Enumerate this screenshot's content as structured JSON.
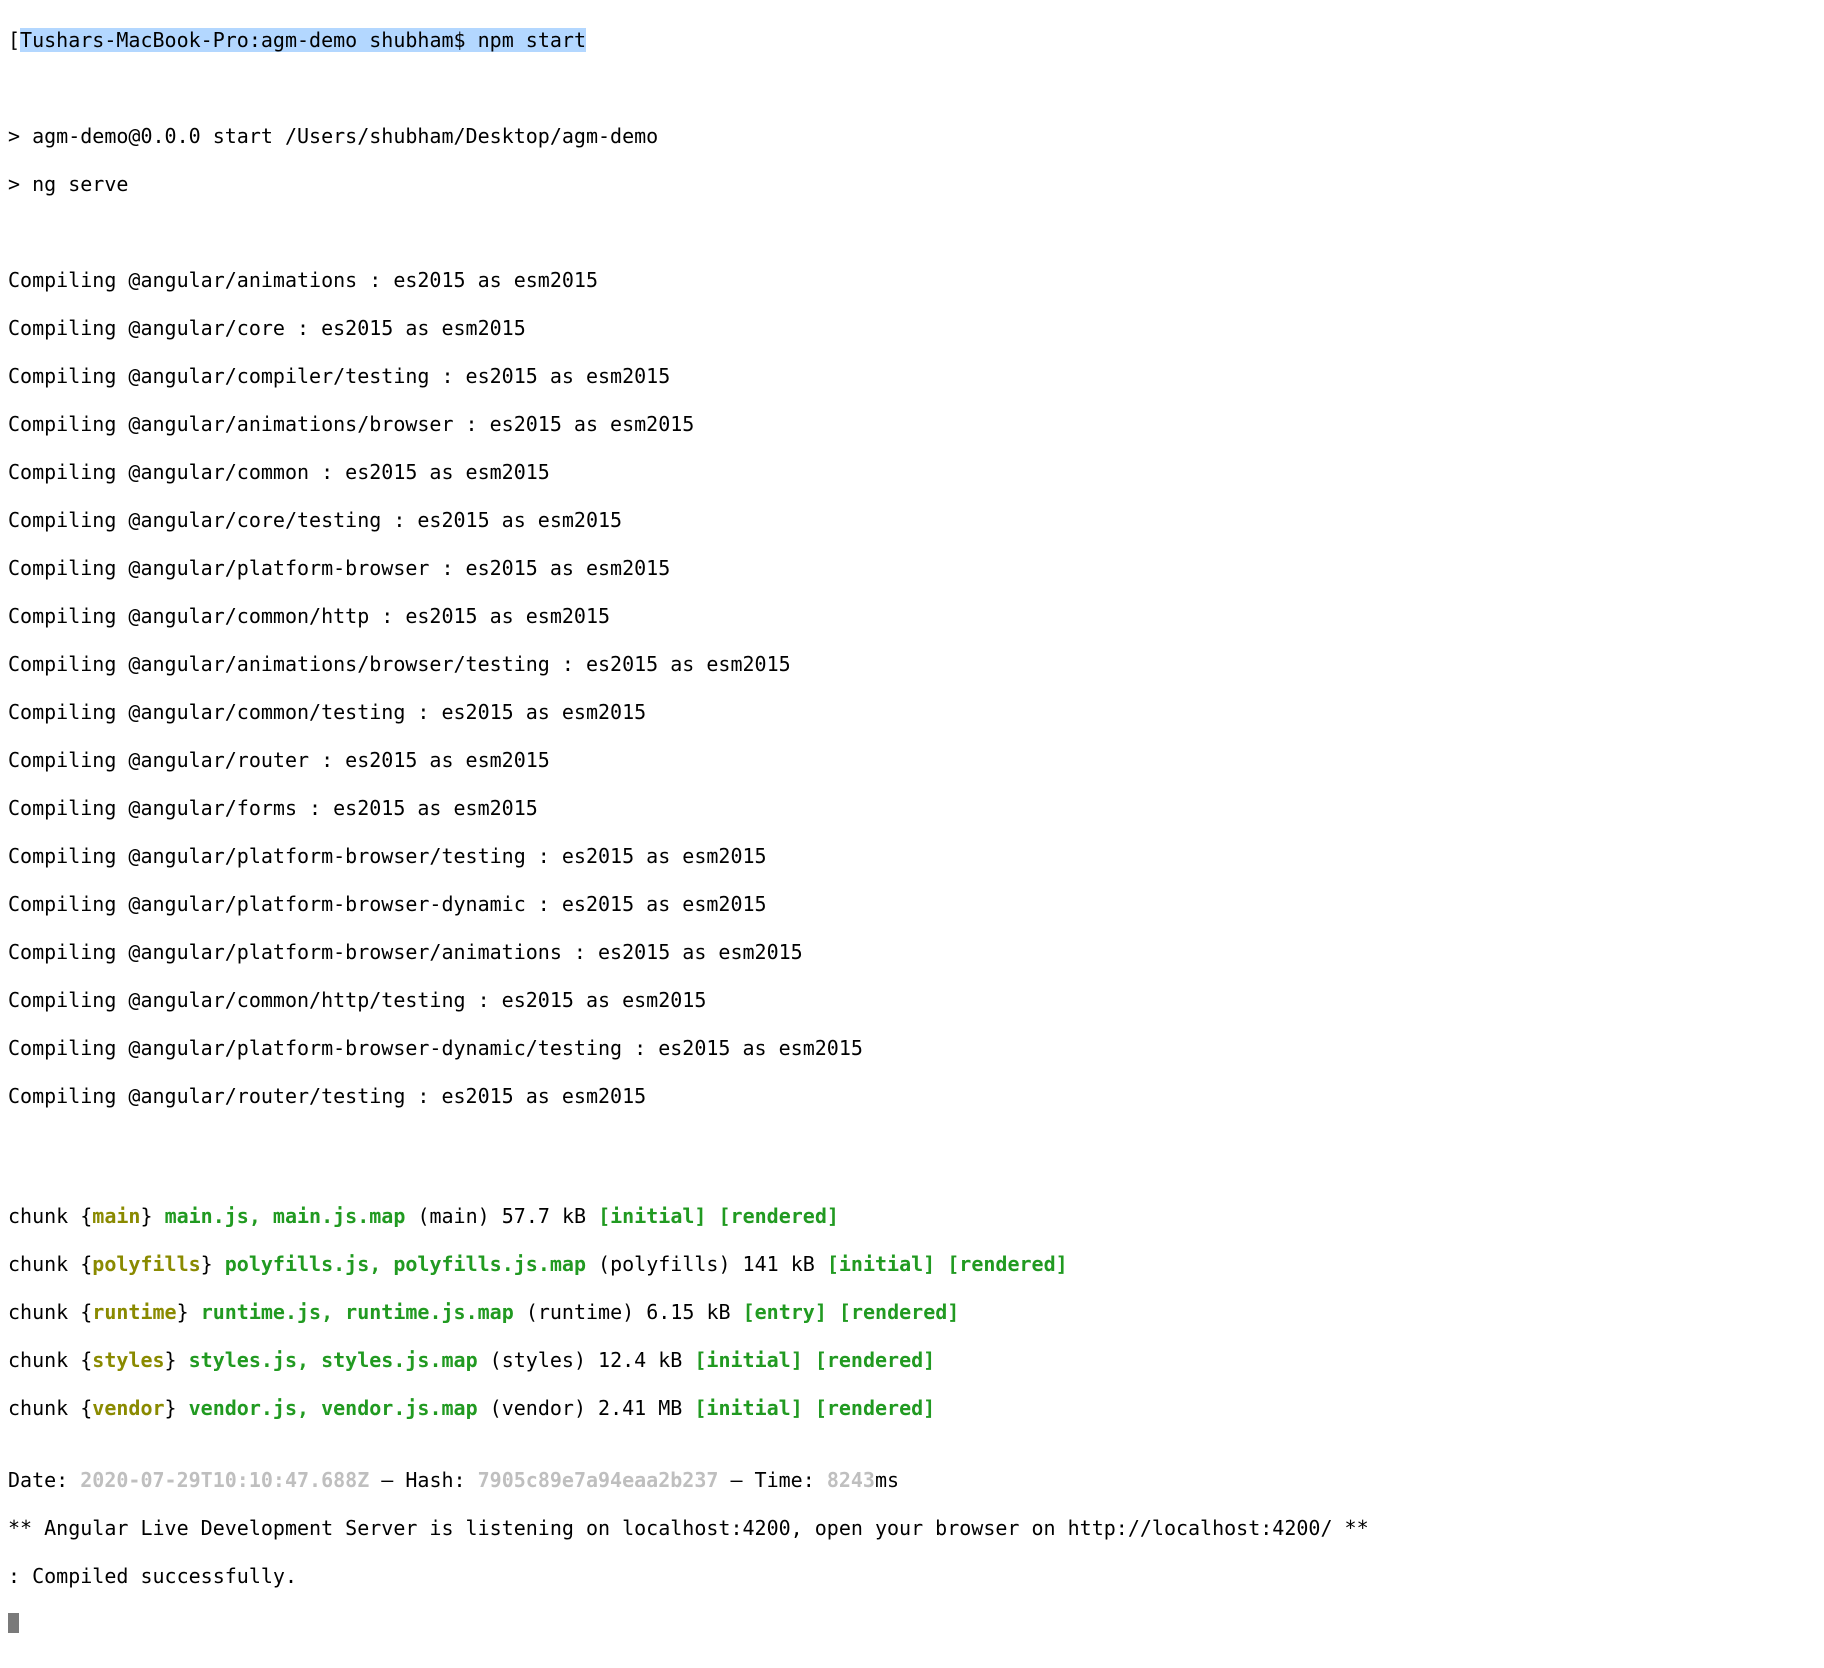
{
  "prompt": {
    "bracket": "[",
    "host_path": "Tushars-MacBook-Pro:agm-demo shubham$ ",
    "command": "npm start"
  },
  "script_lines": [
    "> agm-demo@0.0.0 start /Users/shubham/Desktop/agm-demo",
    "> ng serve"
  ],
  "compile_lines": [
    "Compiling @angular/animations : es2015 as esm2015",
    "Compiling @angular/core : es2015 as esm2015",
    "Compiling @angular/compiler/testing : es2015 as esm2015",
    "Compiling @angular/animations/browser : es2015 as esm2015",
    "Compiling @angular/common : es2015 as esm2015",
    "Compiling @angular/core/testing : es2015 as esm2015",
    "Compiling @angular/platform-browser : es2015 as esm2015",
    "Compiling @angular/common/http : es2015 as esm2015",
    "Compiling @angular/animations/browser/testing : es2015 as esm2015",
    "Compiling @angular/common/testing : es2015 as esm2015",
    "Compiling @angular/router : es2015 as esm2015",
    "Compiling @angular/forms : es2015 as esm2015",
    "Compiling @angular/platform-browser/testing : es2015 as esm2015",
    "Compiling @angular/platform-browser-dynamic : es2015 as esm2015",
    "Compiling @angular/platform-browser/animations : es2015 as esm2015",
    "Compiling @angular/common/http/testing : es2015 as esm2015",
    "Compiling @angular/platform-browser-dynamic/testing : es2015 as esm2015",
    "Compiling @angular/router/testing : es2015 as esm2015"
  ],
  "chunks": [
    {
      "name": "main",
      "files": "main.js, main.js.map",
      "paren": "(main)",
      "size": "57.7 kB",
      "tag1": "[initial]",
      "tag2": "[rendered]"
    },
    {
      "name": "polyfills",
      "files": "polyfills.js, polyfills.js.map",
      "paren": "(polyfills)",
      "size": "141 kB",
      "tag1": "[initial]",
      "tag2": "[rendered]"
    },
    {
      "name": "runtime",
      "files": "runtime.js, runtime.js.map",
      "paren": "(runtime)",
      "size": "6.15 kB",
      "tag1": "[entry]",
      "tag2": "[rendered]"
    },
    {
      "name": "styles",
      "files": "styles.js, styles.js.map",
      "paren": "(styles)",
      "size": "12.4 kB",
      "tag1": "[initial]",
      "tag2": "[rendered]"
    },
    {
      "name": "vendor",
      "files": "vendor.js, vendor.js.map",
      "paren": "(vendor)",
      "size": "2.41 MB",
      "tag1": "[initial]",
      "tag2": "[rendered]"
    }
  ],
  "meta": {
    "date_label": "Date: ",
    "date_value": "2020-07-29T10:10:47.688Z",
    "sep1": " – Hash: ",
    "hash_value": "7905c89e7a94eaa2b237",
    "sep2": " – Time: ",
    "time_value": "8243",
    "time_suffix": "ms"
  },
  "footer": {
    "listening": "** Angular Live Development Server is listening on localhost:4200, open your browser on http://localhost:4200/ **",
    "compiled": ": Compiled successfully."
  },
  "strings": {
    "chunk_prefix": "chunk {",
    "brace_close_space": "} "
  }
}
